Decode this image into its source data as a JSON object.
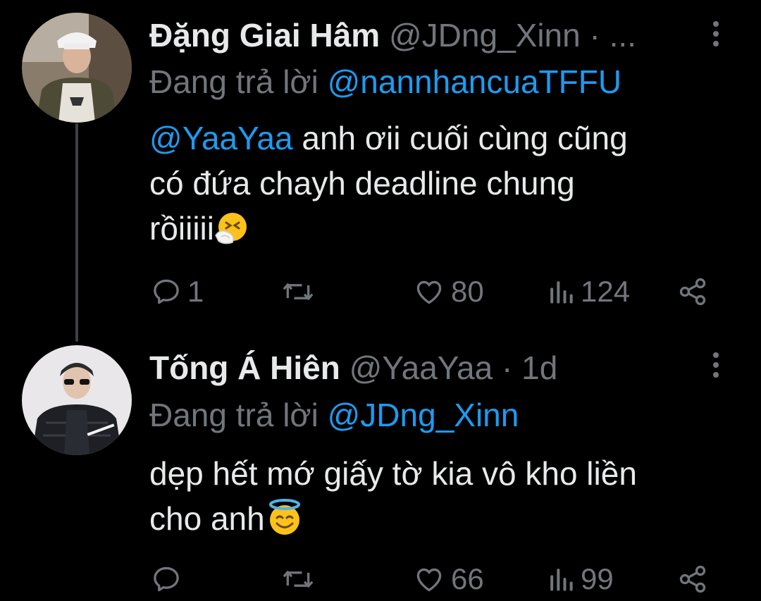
{
  "tweets": [
    {
      "display_name": "Đặng Giai Hâm",
      "handle": "@JDng_Xinn",
      "separator": "·",
      "time": "...",
      "reply_prefix": "Đang trả lời",
      "reply_to": "@nannhancuaTFFU",
      "body_mention": "@YaaYaa",
      "body_line1_rest": " anh ơii cuối cùng cũng",
      "body_line2": "có đứa chayh deadline chung",
      "body_line3": "rồiiiii",
      "emoji": "sneezing-face-emoji",
      "replies": "1",
      "retweets": "",
      "likes": "80",
      "views": "124"
    },
    {
      "display_name": "Tống Á Hiên",
      "handle": "@YaaYaa",
      "separator": "·",
      "time": "1d",
      "reply_prefix": "Đang trả lời",
      "reply_to": "@JDng_Xinn",
      "body_line1": "dẹp hết mớ giấy tờ kia vô kho liền",
      "body_line2": "cho anh",
      "emoji": "smiling-face-with-halo-emoji",
      "replies": "",
      "retweets": "",
      "likes": "66",
      "views": "99"
    }
  ],
  "colors": {
    "background": "#000000",
    "text": "#e7e9ea",
    "muted": "#71767b",
    "accent": "#1d9bf0",
    "thread_line": "#3e4144"
  },
  "icons": [
    "reply-icon",
    "retweet-icon",
    "like-icon",
    "views-icon",
    "share-icon",
    "more-options-icon"
  ]
}
